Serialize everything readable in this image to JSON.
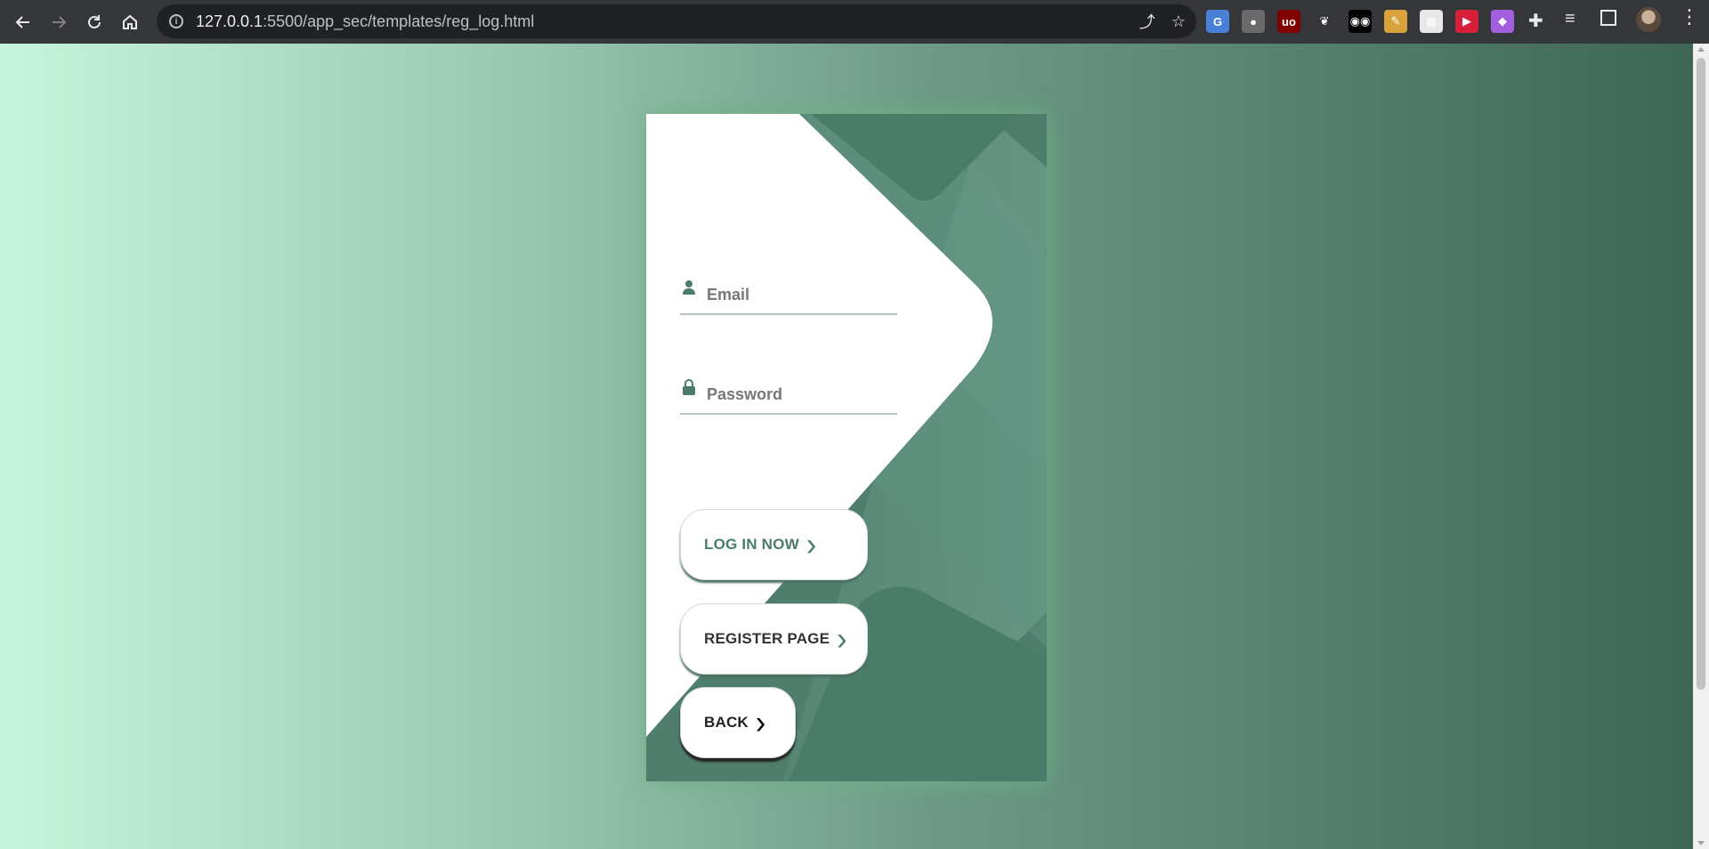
{
  "browser": {
    "url_host": "127.0.0.1",
    "url_path": ":5500/app_sec/templates/reg_log.html",
    "nav": {
      "back_icon": "arrow-left-icon",
      "forward_icon": "arrow-right-icon",
      "reload_icon": "reload-icon",
      "home_icon": "home-icon"
    },
    "extensions": [
      {
        "name": "translate-extension-icon",
        "glyph": "G",
        "color": "#4a7fd6"
      },
      {
        "name": "gray-extension-icon",
        "glyph": "●",
        "color": "#6a6a6a"
      },
      {
        "name": "ublock-extension-icon",
        "glyph": "uo",
        "color": "#800000"
      },
      {
        "name": "gnome-extension-icon",
        "glyph": "❦",
        "color": "#35363a"
      },
      {
        "name": "mask-extension-icon",
        "glyph": "◉◉",
        "color": "#000000"
      },
      {
        "name": "colorful-extension-icon",
        "glyph": "✎",
        "color": "#d9a23a"
      },
      {
        "name": "snapshot-extension-icon",
        "glyph": "▦",
        "color": "#e8e8e8"
      },
      {
        "name": "red-play-extension-icon",
        "glyph": "▶",
        "color": "#d71f3b"
      },
      {
        "name": "purple-extension-icon",
        "glyph": "◆",
        "color": "#a45fe0"
      }
    ]
  },
  "login": {
    "email_placeholder": "Email",
    "password_placeholder": "Password",
    "login_label": "LOG IN NOW",
    "register_label": "REGISTER PAGE",
    "back_label": "BACK",
    "chevron": "›"
  },
  "colors": {
    "accent": "#4a7d69",
    "card_dark": "#4f7e6c",
    "label_dark": "#333333"
  }
}
